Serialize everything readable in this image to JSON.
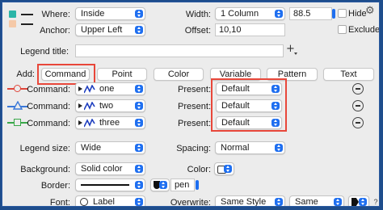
{
  "where": {
    "label": "Where:",
    "value": "Inside"
  },
  "width": {
    "label": "Width:",
    "value": "1 Column",
    "number": "88.5"
  },
  "hide": {
    "label": "Hide"
  },
  "anchor": {
    "label": "Anchor:",
    "value": "Upper Left"
  },
  "offset": {
    "label": "Offset:",
    "value": "10,10"
  },
  "exclude": {
    "label": "Exclude"
  },
  "legend_title": {
    "label": "Legend title:",
    "value": ""
  },
  "add": {
    "label": "Add:",
    "buttons": [
      "Command",
      "Point",
      "Color",
      "Variable",
      "Pattern",
      "Text"
    ]
  },
  "commands": [
    {
      "label": "Command:",
      "name": "one",
      "present_label": "Present:",
      "present": "Default"
    },
    {
      "label": "Command:",
      "name": "two",
      "present_label": "Present:",
      "present": "Default"
    },
    {
      "label": "Command:",
      "name": "three",
      "present_label": "Present:",
      "present": "Default"
    }
  ],
  "legend_size": {
    "label": "Legend size:",
    "value": "Wide"
  },
  "spacing": {
    "label": "Spacing:",
    "value": "Normal"
  },
  "background": {
    "label": "Background:",
    "value": "Solid color"
  },
  "color": {
    "label": "Color:"
  },
  "border": {
    "label": "Border:",
    "pen": "pen"
  },
  "font": {
    "label": "Font:",
    "value": "Label"
  },
  "overwrite": {
    "label": "Overwrite:",
    "value1": "Same Style",
    "value2": "Same"
  },
  "help": "?",
  "colors": {
    "accent": "#1f6ff0",
    "highlight": "#e8473a",
    "marker_red": "#e0453a",
    "marker_blue": "#3a78d8",
    "marker_green": "#3aa84a",
    "swatch_teal": "#2bb5a8",
    "swatch_peach": "#f5c9a8"
  }
}
